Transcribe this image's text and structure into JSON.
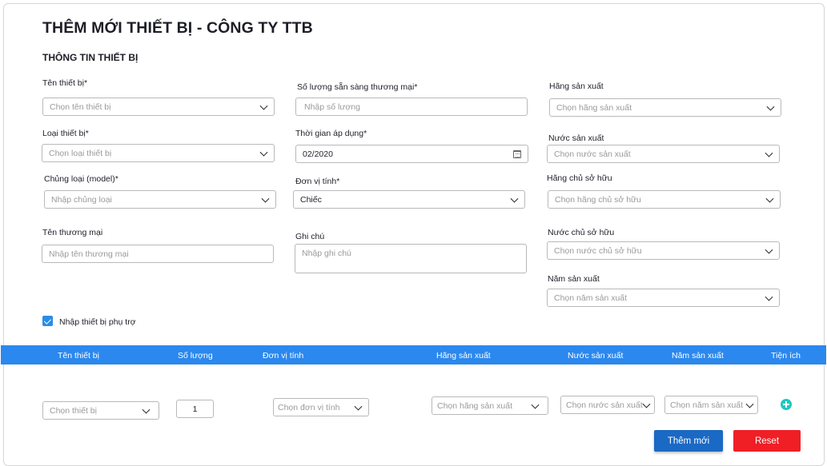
{
  "page": {
    "title": "THÊM MỚI THIẾT BỊ - CÔNG TY TTB",
    "section_title": "THÔNG TIN THIẾT BỊ"
  },
  "form": {
    "ten_thiet_bi": {
      "label": "Tên thiết bị*",
      "placeholder": "Chọn tên thiết bị"
    },
    "loai_thiet_bi": {
      "label": "Loại thiết bị*",
      "placeholder": "Chọn loại thiết bị"
    },
    "chung_loai": {
      "label": "Chủng loại (model)*",
      "placeholder": "Nhập chủng loại"
    },
    "ten_thuong_mai": {
      "label": "Tên thương mại",
      "placeholder": "Nhập tên thương mại"
    },
    "so_luong": {
      "label": "Số lượng sẵn sàng thương mại*",
      "placeholder": "Nhập số lượng"
    },
    "thoi_gian": {
      "label": "Thời gian áp dụng*",
      "value": "02/2020"
    },
    "don_vi_tinh": {
      "label": "Đơn vị tính*",
      "value": "Chiếc"
    },
    "ghi_chu": {
      "label": "Ghi chú",
      "placeholder": "Nhập ghi chú"
    },
    "hang_san_xuat": {
      "label": "Hãng sản xuất",
      "placeholder": "Chọn hãng sản xuất"
    },
    "nuoc_san_xuat": {
      "label": "Nước sản xuất",
      "placeholder": "Chọn nước sản xuất"
    },
    "hang_chu_so_huu": {
      "label": "Hãng chủ sở hữu",
      "placeholder": "Chọn hãng chủ sở hữu"
    },
    "nuoc_chu_so_huu": {
      "label": "Nước chủ sở hữu",
      "placeholder": "Chọn nước chủ sở hữu"
    },
    "nam_san_xuat": {
      "label": "Năm sản xuất",
      "placeholder": "Chọn năm sản xuất"
    },
    "phu_tro": {
      "label": "Nhập thiết bị phụ trợ",
      "checked": true
    }
  },
  "table": {
    "headers": [
      "Tên thiết bị",
      "Số lượng",
      "Đơn vị tính",
      "Hãng sản xuất",
      "Nước sản xuất",
      "Năm sản xuất",
      "Tiện ích"
    ],
    "row": {
      "thiet_bi": "Chọn thiết bị",
      "so_luong": "1",
      "don_vi_tinh": "Chọn đơn vị tính",
      "hang_san_xuat": "Chọn hãng sản xuất",
      "nuoc_san_xuat": "Chọn nước sản xuất",
      "nam_san_xuat": "Chọn năm sản xuất"
    }
  },
  "actions": {
    "add": "Thêm mới",
    "reset": "Reset"
  },
  "colors": {
    "primary": "#2b88ee",
    "add_button": "#1a69c4",
    "reset_button": "#ef1f25",
    "add_row": "#1ec8c0"
  }
}
